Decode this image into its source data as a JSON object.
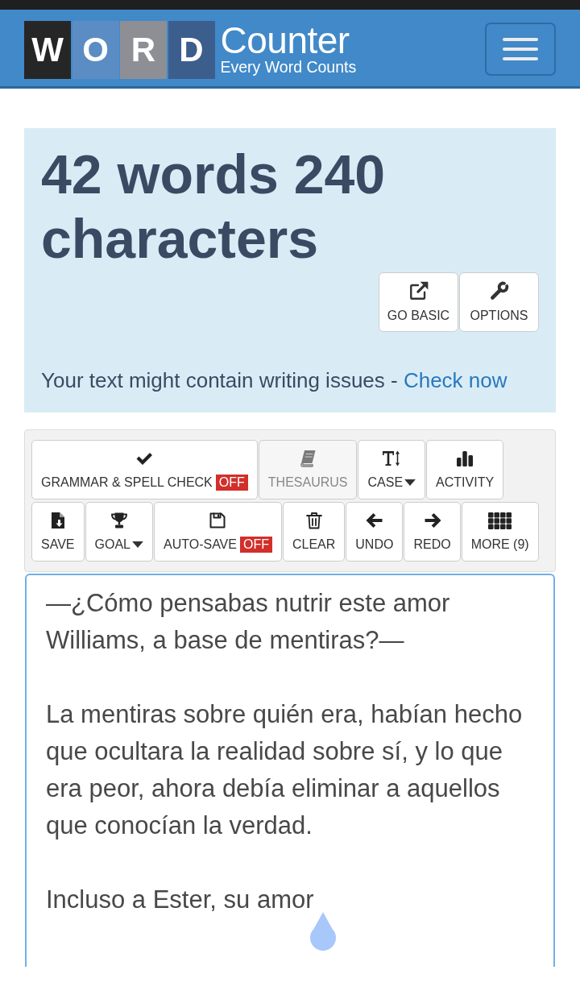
{
  "header": {
    "logo": {
      "tiles": [
        {
          "letter": "W",
          "color": "#262626"
        },
        {
          "letter": "O",
          "color": "#5b8dc4"
        },
        {
          "letter": "R",
          "color": "#8d8f94"
        },
        {
          "letter": "D",
          "color": "#3c5e8c"
        }
      ],
      "title": "Counter",
      "tagline": "Every Word Counts"
    }
  },
  "stats": {
    "headline": "42 words 240 characters",
    "actions": [
      {
        "label": "GO BASIC"
      },
      {
        "label": "OPTIONS"
      }
    ],
    "notice": {
      "text": "Your text might contain writing issues - ",
      "link": "Check now"
    }
  },
  "toolbar": {
    "buttons": [
      {
        "label": "GRAMMAR & SPELL CHECK",
        "badge": "OFF",
        "dropdown": false,
        "disabled": false
      },
      {
        "label": "THESAURUS",
        "dropdown": false,
        "disabled": true
      },
      {
        "label": "CASE",
        "dropdown": true,
        "disabled": false
      },
      {
        "label": "ACTIVITY",
        "dropdown": false,
        "disabled": false
      },
      {
        "label": "SAVE",
        "dropdown": false,
        "disabled": false
      },
      {
        "label": "GOAL",
        "dropdown": true,
        "disabled": false
      },
      {
        "label": "AUTO-SAVE",
        "badge": "OFF",
        "dropdown": false,
        "disabled": false
      },
      {
        "label": "CLEAR",
        "dropdown": false,
        "disabled": false
      },
      {
        "label": "UNDO",
        "dropdown": false,
        "disabled": false
      },
      {
        "label": "REDO",
        "dropdown": false,
        "disabled": false
      },
      {
        "label": "MORE (9)",
        "dropdown": false,
        "disabled": false
      }
    ]
  },
  "editor": {
    "value": "—¿Cómo pensabas nutrir este amor Williams, a base de mentiras?—\n\nLa mentiras sobre quién era, habían hecho que ocultara la realidad sobre sí, y lo que era peor, ahora debía eliminar a aquellos que conocían la verdad.\n\nIncluso a Ester, su amor",
    "focused": true
  }
}
